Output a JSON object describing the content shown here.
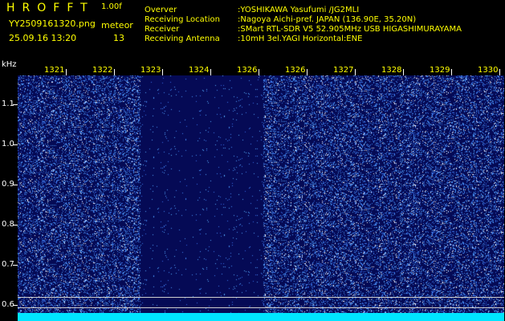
{
  "header": {
    "brand": "HROFFT",
    "version": "1.00f",
    "filename": "YY2509161320.png",
    "datetime": "25.09.16 13:20",
    "meteor_label": "meteor",
    "meteor_count": "13"
  },
  "info": {
    "labels": [
      "Overver",
      "Receiving Location",
      "Receiver",
      "Receiving Antenna"
    ],
    "values": [
      ":YOSHIKAWA Yasufumi /JG2MLI",
      ":Nagoya Aichi-pref. JAPAN (136.90E, 35.20N)",
      ":SMart RTL-SDR V5 52.905MHz USB HIGASHIMURAYAMA",
      ":10mH 3el.YAGI Horizontal:ENE"
    ]
  },
  "axis": {
    "unit": "kHz",
    "y_ticks": [
      "1.1",
      "1.0",
      "0.9",
      "0.8",
      "0.7",
      "0.6"
    ],
    "x_ticks": [
      "1321",
      "1322",
      "1323",
      "1324",
      "1326",
      "1326",
      "1327",
      "1328",
      "1329",
      "1330"
    ]
  },
  "colors": {
    "background": "#000000",
    "text": "#ffff00",
    "spectrogram_dark": "#050a55",
    "noise": "#3a7bff",
    "bottom_bar": "#00e5ff"
  }
}
